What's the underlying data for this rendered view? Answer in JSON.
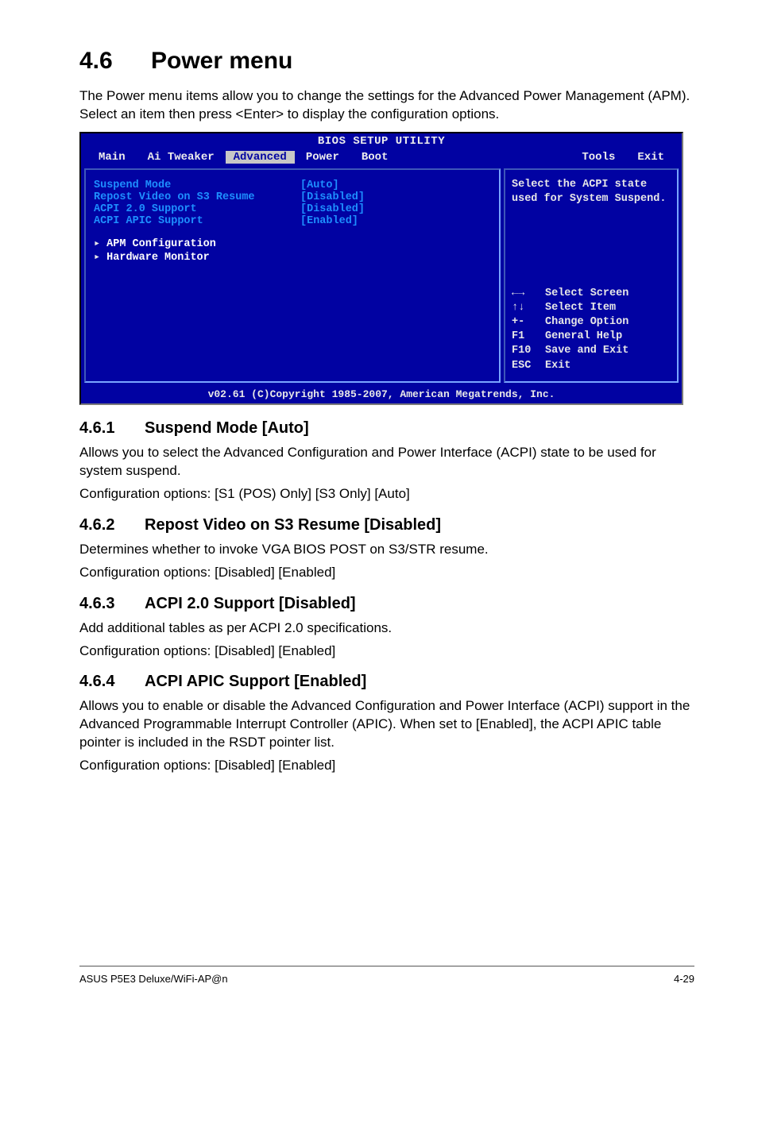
{
  "section": {
    "num": "4.6",
    "title": "Power menu"
  },
  "intro": "The Power menu items allow you to change the settings for the Advanced Power Management (APM). Select an item then press <Enter> to display the configuration options.",
  "bios": {
    "title": "BIOS SETUP UTILITY",
    "tabs": {
      "main": "Main",
      "ai": "Ai Tweaker",
      "adv": "Advanced",
      "power": "Power",
      "boot": "Boot",
      "tools": "Tools",
      "exit": "Exit"
    },
    "items": {
      "r0": {
        "label": "Suspend Mode",
        "value": "[Auto]"
      },
      "r1": {
        "label": "Repost Video on S3 Resume",
        "value": "[Disabled]"
      },
      "r2": {
        "label": "ACPI 2.0 Support",
        "value": "[Disabled]"
      },
      "r3": {
        "label": "ACPI APIC Support",
        "value": "[Enabled]"
      },
      "s0": "APM Configuration",
      "s1": "Hardware Monitor"
    },
    "help_top": "Select the ACPI state used for System Suspend.",
    "legend": {
      "l0": {
        "k": "←→",
        "v": "Select Screen"
      },
      "l1": {
        "k": "↑↓",
        "v": "Select Item"
      },
      "l2": {
        "k": "+-",
        "v": "Change Option"
      },
      "l3": {
        "k": "F1",
        "v": "General Help"
      },
      "l4": {
        "k": "F10",
        "v": "Save and Exit"
      },
      "l5": {
        "k": "ESC",
        "v": "Exit"
      }
    },
    "footer": "v02.61 (C)Copyright 1985-2007, American Megatrends, Inc."
  },
  "s461": {
    "num": "4.6.1",
    "title": "Suspend Mode [Auto]",
    "p1": "Allows you to select the Advanced Configuration and Power Interface (ACPI) state to be used for system suspend.",
    "p2": "Configuration options: [S1 (POS) Only] [S3 Only] [Auto]"
  },
  "s462": {
    "num": "4.6.2",
    "title": "Repost Video on S3 Resume [Disabled]",
    "p1": "Determines whether to invoke VGA BIOS POST on S3/STR resume.",
    "p2": "Configuration options: [Disabled] [Enabled]"
  },
  "s463": {
    "num": "4.6.3",
    "title": "ACPI 2.0 Support [Disabled]",
    "p1": "Add additional tables as per ACPI 2.0 specifications.",
    "p2": "Configuration options: [Disabled] [Enabled]"
  },
  "s464": {
    "num": "4.6.4",
    "title": "ACPI APIC Support [Enabled]",
    "p1": "Allows you to enable or disable the Advanced Configuration and Power Interface (ACPI) support in the Advanced Programmable Interrupt Controller (APIC). When set to [Enabled], the ACPI APIC table pointer is included in the RSDT pointer list.",
    "p2": "Configuration options: [Disabled] [Enabled]"
  },
  "footer": {
    "left": "ASUS P5E3 Deluxe/WiFi-AP@n",
    "right": "4-29"
  }
}
